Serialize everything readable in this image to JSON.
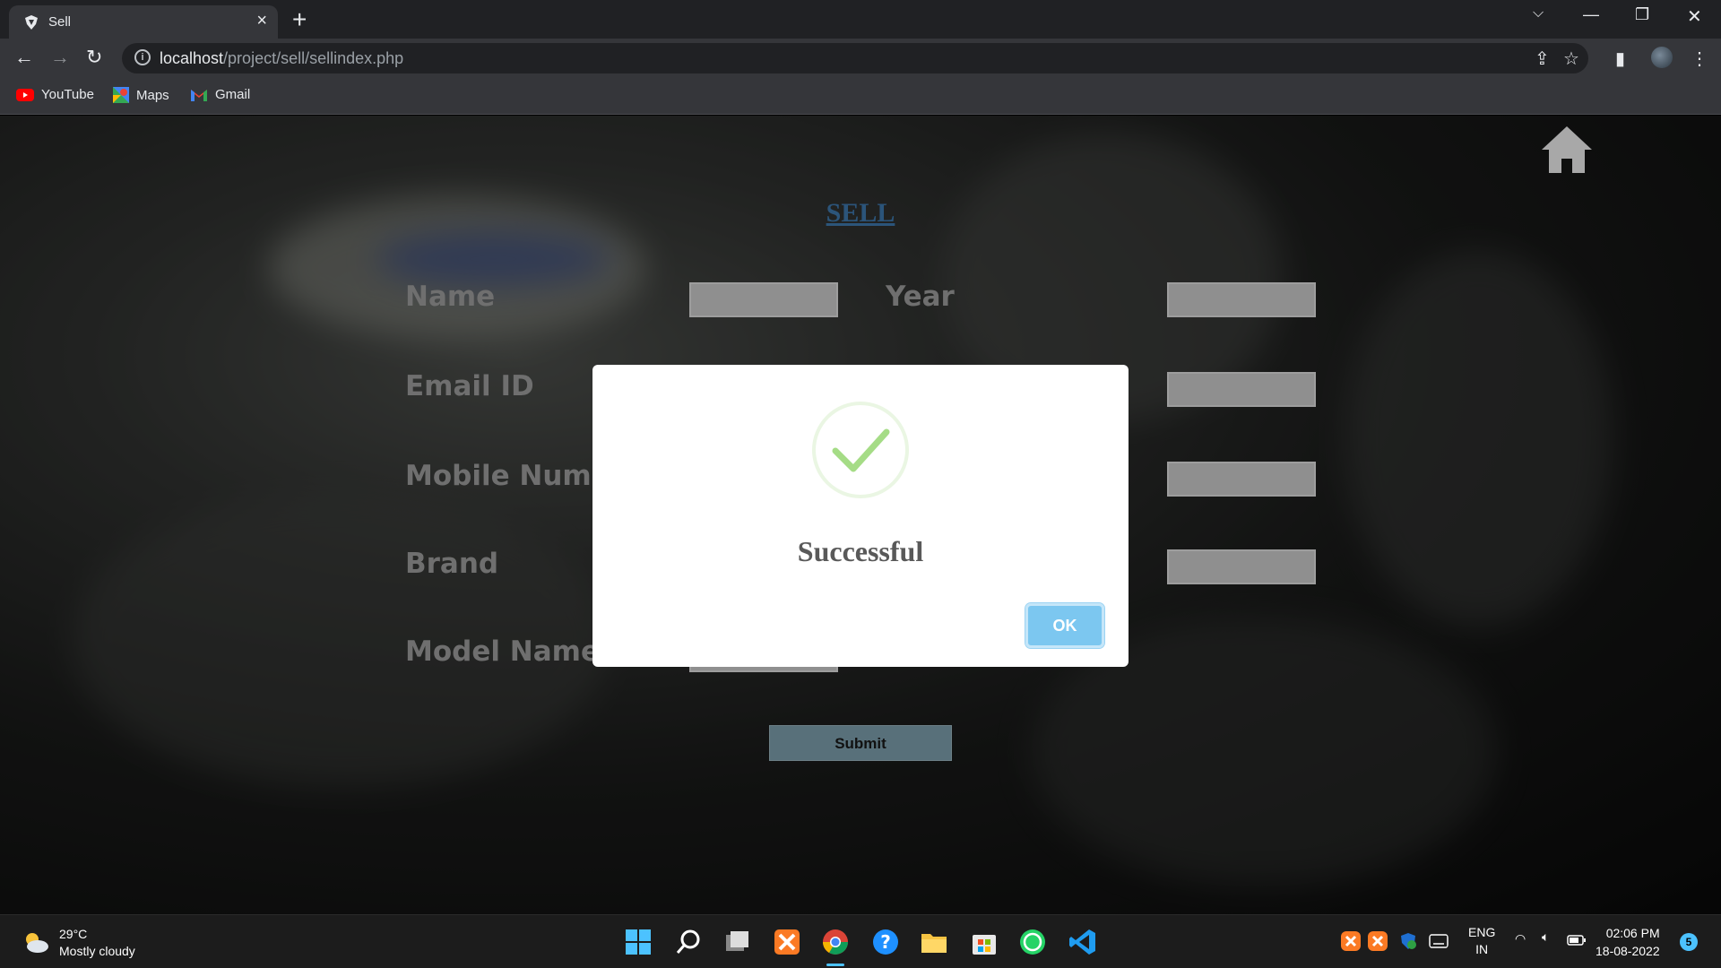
{
  "browser": {
    "tab_title": "Sell",
    "url_host": "localhost",
    "url_path": "/project/sell/sellindex.php",
    "bookmarks": [
      {
        "label": "YouTube",
        "icon": "youtube-icon"
      },
      {
        "label": "Maps",
        "icon": "maps-icon"
      },
      {
        "label": "Gmail",
        "icon": "gmail-icon"
      }
    ]
  },
  "page": {
    "title": "SELL",
    "fields": {
      "name": "Name",
      "year": "Year",
      "email": "Email ID",
      "mobile": "Mobile Num",
      "brand": "Brand",
      "model": "Model Name"
    },
    "submit_label": "Submit"
  },
  "modal": {
    "message": "Successful",
    "ok_label": "OK",
    "check_color": "#a5dc86"
  },
  "taskbar": {
    "temperature": "29°C",
    "condition": "Mostly cloudy",
    "lang_1": "ENG",
    "lang_2": "IN",
    "time": "02:06 PM",
    "date": "18-08-2022",
    "notification_count": "5"
  }
}
